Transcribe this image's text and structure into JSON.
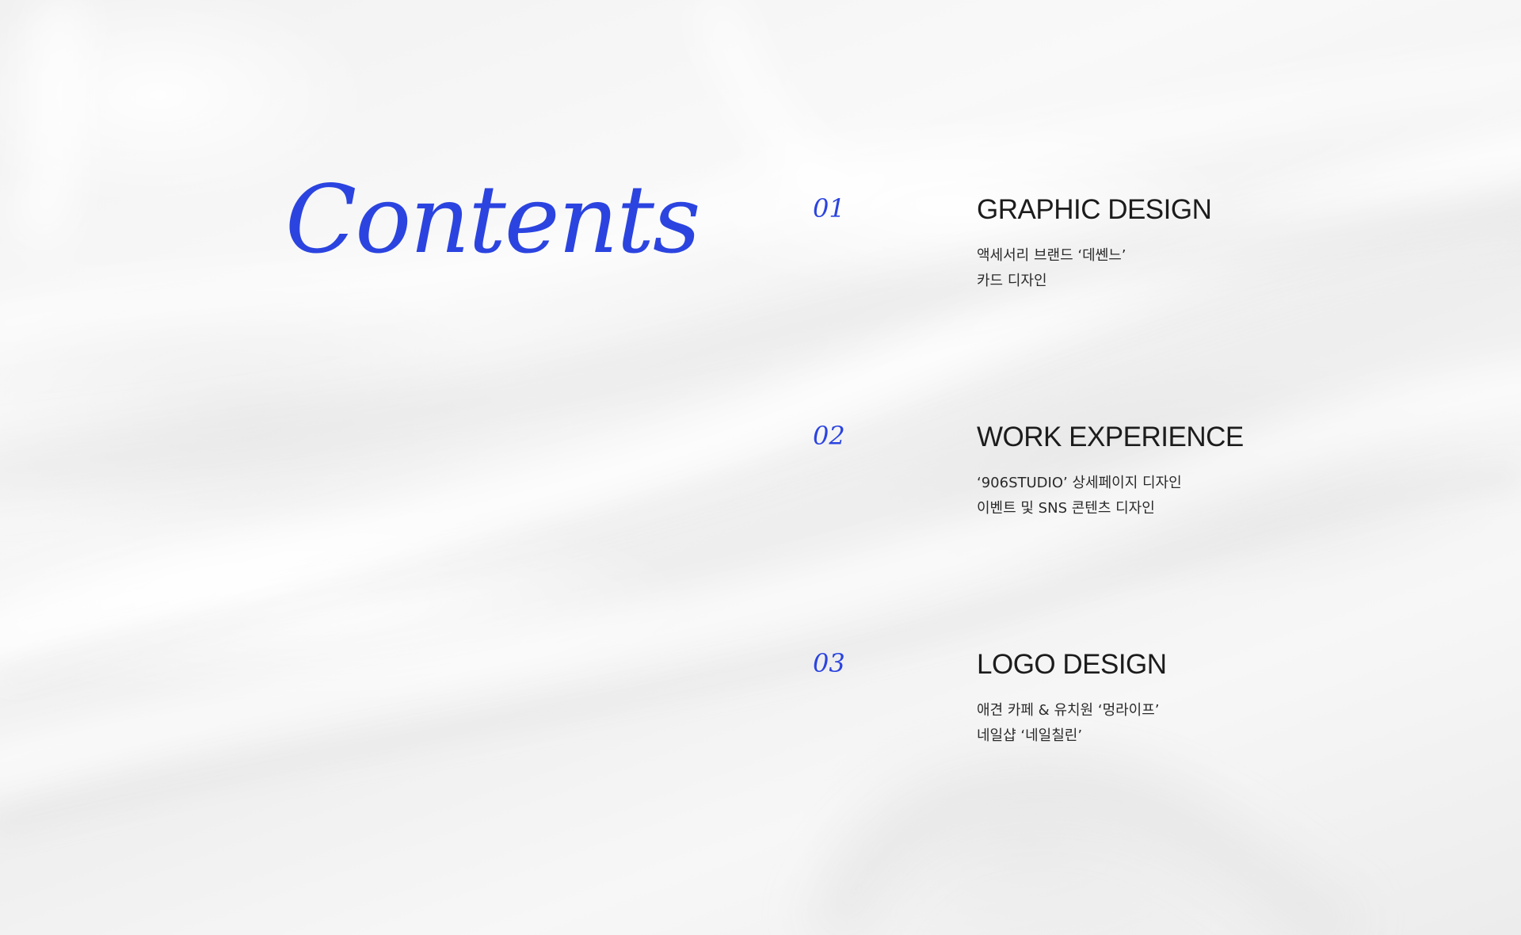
{
  "title": "Contents",
  "items": [
    {
      "number": "01",
      "heading": "GRAPHIC DESIGN",
      "lines": [
        "액세서리 브랜드 ‘데쎈느’",
        "카드 디자인"
      ]
    },
    {
      "number": "02",
      "heading": "WORK EXPERIENCE",
      "lines": [
        "‘906STUDIO’ 상세페이지 디자인",
        "이벤트 및 SNS 콘텐츠 디자인"
      ]
    },
    {
      "number": "03",
      "heading": "LOGO DESIGN",
      "lines": [
        "애견 카페 & 유치원 ‘멍라이프’",
        "네일샵 ‘네일칠린’"
      ]
    }
  ],
  "colors": {
    "accent": "#2b44e0",
    "text": "#1c1c1c",
    "background": "#f3f3f3"
  }
}
